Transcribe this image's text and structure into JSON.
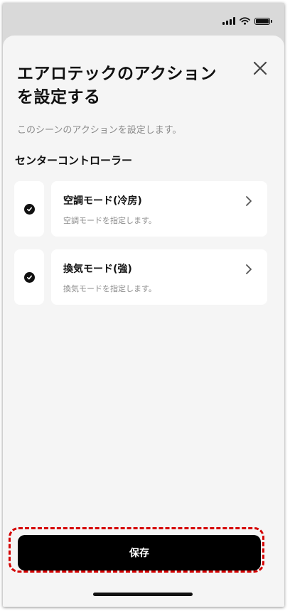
{
  "status_bar": {
    "icons": [
      "signal-icon",
      "wifi-icon",
      "battery-icon"
    ]
  },
  "sheet": {
    "title_line1": "エアロテックのアクション",
    "title_line2": "を設定する",
    "close_icon": "close-icon",
    "subtitle": "このシーンのアクションを設定します。",
    "section_title": "センターコントローラー",
    "actions": [
      {
        "name": "空調モード(冷房)",
        "description": "空調モードを指定します。",
        "checked": true
      },
      {
        "name": "換気モード(強)",
        "description": "換気モードを指定します。",
        "checked": true
      }
    ],
    "save_label": "保存"
  },
  "colors": {
    "sheet_background": "#f5f5f5",
    "card_background": "#ffffff",
    "primary_button": "#000000",
    "highlight_dashed_border": "#d40000",
    "secondary_text": "#8a8a8a"
  }
}
